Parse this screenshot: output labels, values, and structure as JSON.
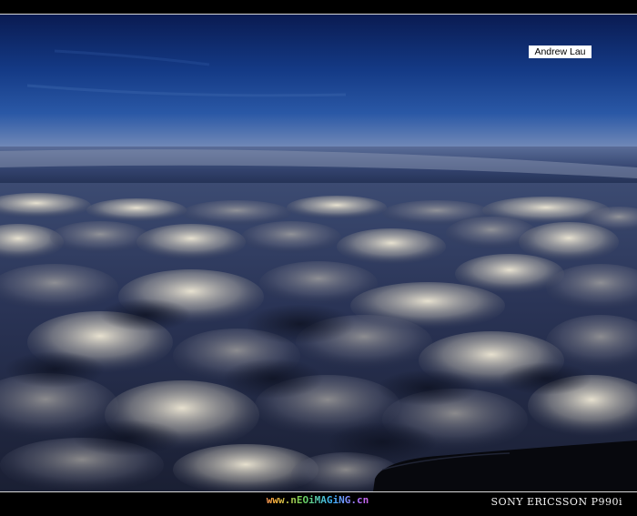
{
  "photo": {
    "credit": "Andrew Lau",
    "site_watermark": "www.nEOiMAGiNG.cn",
    "camera_model": "SONY ERICSSON P990i"
  },
  "colors": {
    "sky_top": "#0a1e58",
    "sky_mid": "#1d4fa0",
    "horizon": "#7a8cb0",
    "cloud_highlight": "#e9e2cf",
    "cloud_shadow": "#1b2440",
    "frame": "#000000"
  }
}
